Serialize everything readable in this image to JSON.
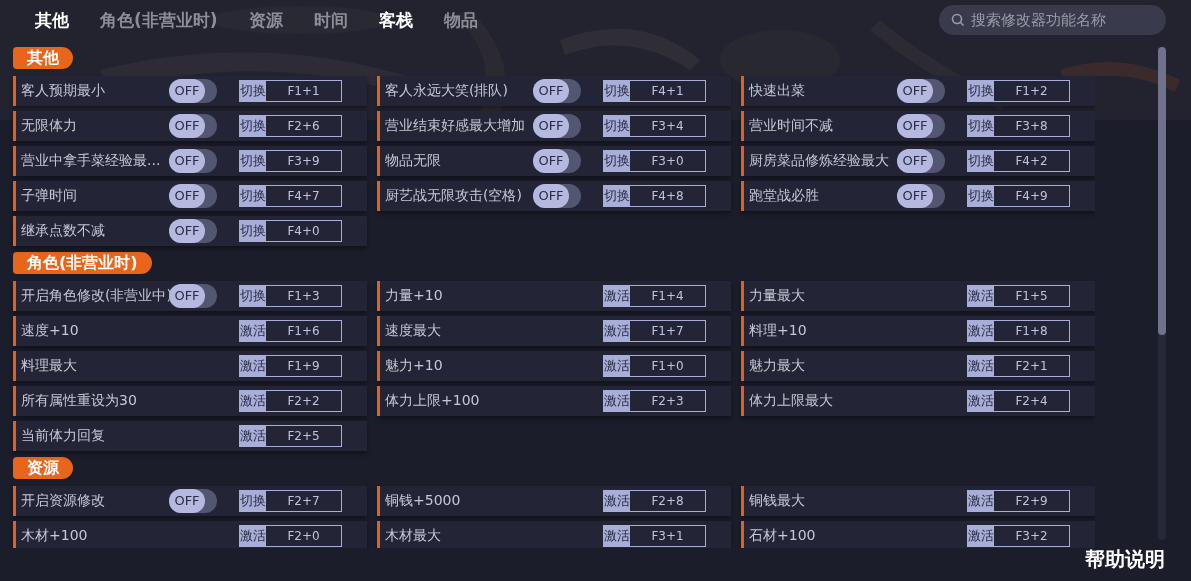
{
  "tabs": [
    {
      "label": "其他",
      "selected": true
    },
    {
      "label": "角色(非营业时)",
      "selected": false
    },
    {
      "label": "资源",
      "selected": false
    },
    {
      "label": "时间",
      "selected": false
    },
    {
      "label": "客栈",
      "selected": true
    },
    {
      "label": "物品",
      "selected": false
    }
  ],
  "search": {
    "placeholder": "搜索修改器功能名称"
  },
  "sections": [
    {
      "title": "其他",
      "items": [
        {
          "label": "客人预期最小",
          "kind": "toggle",
          "on": false,
          "switch_text": "OFF",
          "action": "切换",
          "key": "F1+1"
        },
        {
          "label": "客人永远大笑(排队)",
          "kind": "toggle",
          "on": false,
          "switch_text": "OFF",
          "action": "切换",
          "key": "F4+1"
        },
        {
          "label": "快速出菜",
          "kind": "toggle",
          "on": false,
          "switch_text": "OFF",
          "action": "切换",
          "key": "F1+2"
        },
        {
          "label": "无限体力",
          "kind": "toggle",
          "on": false,
          "switch_text": "OFF",
          "action": "切换",
          "key": "F2+6"
        },
        {
          "label": "营业结束好感最大增加",
          "kind": "toggle",
          "on": false,
          "switch_text": "OFF",
          "action": "切换",
          "key": "F3+4"
        },
        {
          "label": "营业时间不减",
          "kind": "toggle",
          "on": false,
          "switch_text": "OFF",
          "action": "切换",
          "key": "F3+8"
        },
        {
          "label": "营业中拿手菜经验最...",
          "kind": "toggle",
          "on": false,
          "switch_text": "OFF",
          "action": "切换",
          "key": "F3+9"
        },
        {
          "label": "物品无限",
          "kind": "toggle",
          "on": false,
          "switch_text": "OFF",
          "action": "切换",
          "key": "F3+0"
        },
        {
          "label": "厨房菜品修炼经验最大",
          "kind": "toggle",
          "on": false,
          "switch_text": "OFF",
          "action": "切换",
          "key": "F4+2"
        },
        {
          "label": "子弹时间",
          "kind": "toggle",
          "on": false,
          "switch_text": "OFF",
          "action": "切换",
          "key": "F4+7"
        },
        {
          "label": "厨艺战无限攻击(空格)",
          "kind": "toggle",
          "on": false,
          "switch_text": "OFF",
          "action": "切换",
          "key": "F4+8"
        },
        {
          "label": "跑堂战必胜",
          "kind": "toggle",
          "on": false,
          "switch_text": "OFF",
          "action": "切换",
          "key": "F4+9"
        },
        {
          "label": "继承点数不减",
          "kind": "toggle",
          "on": false,
          "switch_text": "OFF",
          "action": "切换",
          "key": "F4+0"
        }
      ]
    },
    {
      "title": "角色(非营业时)",
      "items": [
        {
          "label": "开启角色修改(非营业中)",
          "kind": "toggle",
          "on": false,
          "switch_text": "OFF",
          "action": "切换",
          "key": "F1+3"
        },
        {
          "label": "力量+10",
          "kind": "button",
          "action": "激活",
          "key": "F1+4"
        },
        {
          "label": "力量最大",
          "kind": "button",
          "action": "激活",
          "key": "F1+5"
        },
        {
          "label": "速度+10",
          "kind": "button",
          "action": "激活",
          "key": "F1+6"
        },
        {
          "label": "速度最大",
          "kind": "button",
          "action": "激活",
          "key": "F1+7"
        },
        {
          "label": "料理+10",
          "kind": "button",
          "action": "激活",
          "key": "F1+8"
        },
        {
          "label": "料理最大",
          "kind": "button",
          "action": "激活",
          "key": "F1+9"
        },
        {
          "label": "魅力+10",
          "kind": "button",
          "action": "激活",
          "key": "F1+0"
        },
        {
          "label": "魅力最大",
          "kind": "button",
          "action": "激活",
          "key": "F2+1"
        },
        {
          "label": "所有属性重设为30",
          "kind": "button",
          "action": "激活",
          "key": "F2+2"
        },
        {
          "label": "体力上限+100",
          "kind": "button",
          "action": "激活",
          "key": "F2+3"
        },
        {
          "label": "体力上限最大",
          "kind": "button",
          "action": "激活",
          "key": "F2+4"
        },
        {
          "label": "当前体力回复",
          "kind": "button",
          "action": "激活",
          "key": "F2+5"
        }
      ]
    },
    {
      "title": "资源",
      "items": [
        {
          "label": "开启资源修改",
          "kind": "toggle",
          "on": false,
          "switch_text": "OFF",
          "action": "切换",
          "key": "F2+7"
        },
        {
          "label": "铜钱+5000",
          "kind": "button",
          "action": "激活",
          "key": "F2+8"
        },
        {
          "label": "铜钱最大",
          "kind": "button",
          "action": "激活",
          "key": "F2+9"
        },
        {
          "label": "木材+100",
          "kind": "button",
          "action": "激活",
          "key": "F2+0"
        },
        {
          "label": "木材最大",
          "kind": "button",
          "action": "激活",
          "key": "F3+1"
        },
        {
          "label": "石材+100",
          "kind": "button",
          "action": "激活",
          "key": "F3+2"
        }
      ]
    }
  ],
  "help_button": "帮助说明"
}
